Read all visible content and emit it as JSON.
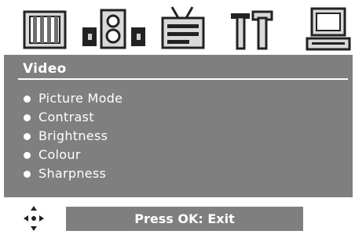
{
  "icons": [
    {
      "name": "picture-icon"
    },
    {
      "name": "sound-icon"
    },
    {
      "name": "tv-icon"
    },
    {
      "name": "setup-tools-icon"
    },
    {
      "name": "pc-icon"
    }
  ],
  "panel": {
    "title": "Video",
    "items": [
      "Picture Mode",
      "Contrast",
      "Brightness",
      "Colour",
      "Sharpness"
    ]
  },
  "footer": {
    "nav_icon": "navigation-arrows-icon",
    "exit_label": "Press OK: Exit"
  },
  "colors": {
    "panel_bg": "#7f7f7f",
    "text": "#ffffff",
    "icon_stroke": "#222222"
  }
}
